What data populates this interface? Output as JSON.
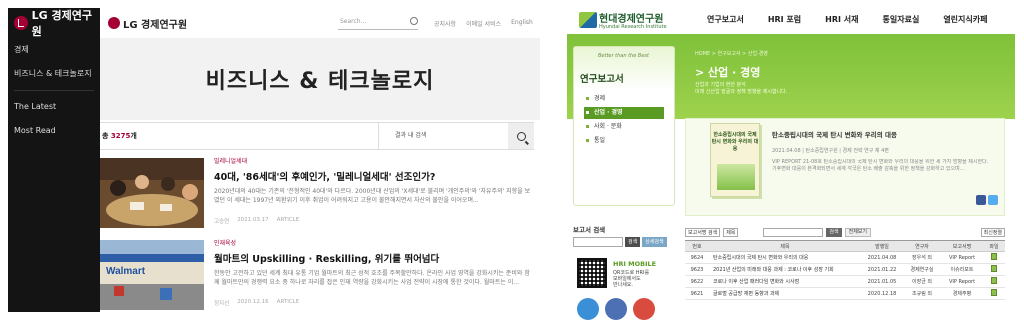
{
  "lg": {
    "logo": "LG 경제연구원",
    "brand": "LG 경제연구원",
    "sidebar": {
      "items": [
        "경제",
        "비즈니스 & 테크놀로지",
        "The Latest",
        "Most Read"
      ]
    },
    "search_placeholder": "Search...",
    "top_links": [
      "공지사항",
      "이메일 서비스",
      "English"
    ],
    "hero_title": "비즈니스 & 테크놀로지",
    "count_prefix": "총 ",
    "count_value": "3275",
    "count_suffix": "개",
    "inner_search_placeholder": "결과 내 검색",
    "articles": [
      {
        "category": "밀레니얼세대",
        "title": "40대, '86세대'의 후예인가, '밀레니얼세대' 선조인가?",
        "desc": "2020년대의 40대는 기존의 '전형적인 40대'와 다르다. 2000년대 산업의 'X세대'로 불리며 '개인주의'와 '자유주의' 지향을 보였던 이 세대는 1997년 외환위기 이후 취업이 어려워지고 고용이 불안해지면서 자산의 불안을 이어오며...",
        "author": "고승연",
        "date": "2021.03.17",
        "type": "ARTICLE"
      },
      {
        "category": "인재육성",
        "title": "월마트의 Upskilling · Reskilling, 위기를 뛰어넘다",
        "desc": "한동안 고전하고 있던 세계 최대 유통 기업 월마트의 최근 성적 호조를 주목할만하다. 온라인 사업 영역을 강화시키는 준비와 함께 월마트만의 경쟁력 요소 중 하나로 자리를 잡은 인재 역량을 강화시키는 사업 전략이 시장에 통한 것이다. 월마트는 이...",
        "author": "정지선",
        "date": "2020.12.16",
        "type": "ARTICLE"
      }
    ],
    "colors": {
      "accent": "#a50034",
      "sidebar": "#141414"
    }
  },
  "hri": {
    "logo_title": "현대경제연구원",
    "logo_sub": "Hyundai Research Institute",
    "menu": [
      "연구보고서",
      "HRI 포럼",
      "HRI 서재",
      "통일자료실",
      "열린지식카페"
    ],
    "left_pane": {
      "slogan": "Better than the Best",
      "title": "연구보고서",
      "items": [
        "경제",
        "산업 · 경영",
        "사회 · 문화",
        "통일"
      ],
      "active_index": 1
    },
    "breadcrumb": "HOME > 연구보고서 > 산업·경영",
    "section_title": "> 산업 · 경영",
    "section_desc_1": "산업과 기업의 현안 분석",
    "section_desc_2": "미래 신산업 발굴과 정책 방향을 제시합니다.",
    "featured": {
      "book_title": "한소중립시대의 국제 탄시 변화와 우리의 대응",
      "title": "탄소중립시대의 국제 탄시 변화와 우리의 대응",
      "meta": "2021.04.08 | 탄소중립연구원 | 경제 전략 연구 제 4편",
      "desc": "VIP REPORT 21-08호 탄소중립시대의 국제 탄시 변화와 우리의 대응을 위한 세 가지 방향을 제시한다. 기후변화 대응이 본격화되면서 세계 각국은 탄소 배출 감축을 위한 정책을 강화하고 있으며..."
    },
    "search_box": {
      "title": "보고서 검색",
      "btn": "검색",
      "btn2": "상세검색"
    },
    "mobile": {
      "title": "HRI MOBILE",
      "desc_1": "QR코드로 HRI를",
      "desc_2": "모바일에서도",
      "desc_3": "만나세요."
    },
    "filter": {
      "sel1": "보고서명 검색",
      "sel2": "제목",
      "btn": "검색",
      "btn2": "전체보기",
      "sel3": "최신정렬"
    },
    "table": {
      "headers": [
        "번호",
        "제목",
        "발행일",
        "연구자",
        "보고서명",
        "파일"
      ],
      "rows": [
        [
          "9624",
          "탄소중립시대의 국제 탄시 변화와 우리의 대응",
          "2021.04.08",
          "장우석 외",
          "VIP Report",
          ""
        ],
        [
          "9623",
          "2021년 산업의 미래와 대응 과제 : 코로나 이후 성장 기회",
          "2021.01.22",
          "경제연구실",
          "이슈리포트",
          ""
        ],
        [
          "9622",
          "코로나 이후 산업 패러다임 변화와 시사점",
          "2021.01.05",
          "이장균 외",
          "VIP Report",
          ""
        ],
        [
          "9621",
          "글로벌 공급망 재편 동향과 과제",
          "2020.12.18",
          "조규림 외",
          "경제주평",
          ""
        ]
      ]
    },
    "colors": {
      "green": "#7fc13a",
      "dark_green": "#1f5e2e"
    }
  }
}
